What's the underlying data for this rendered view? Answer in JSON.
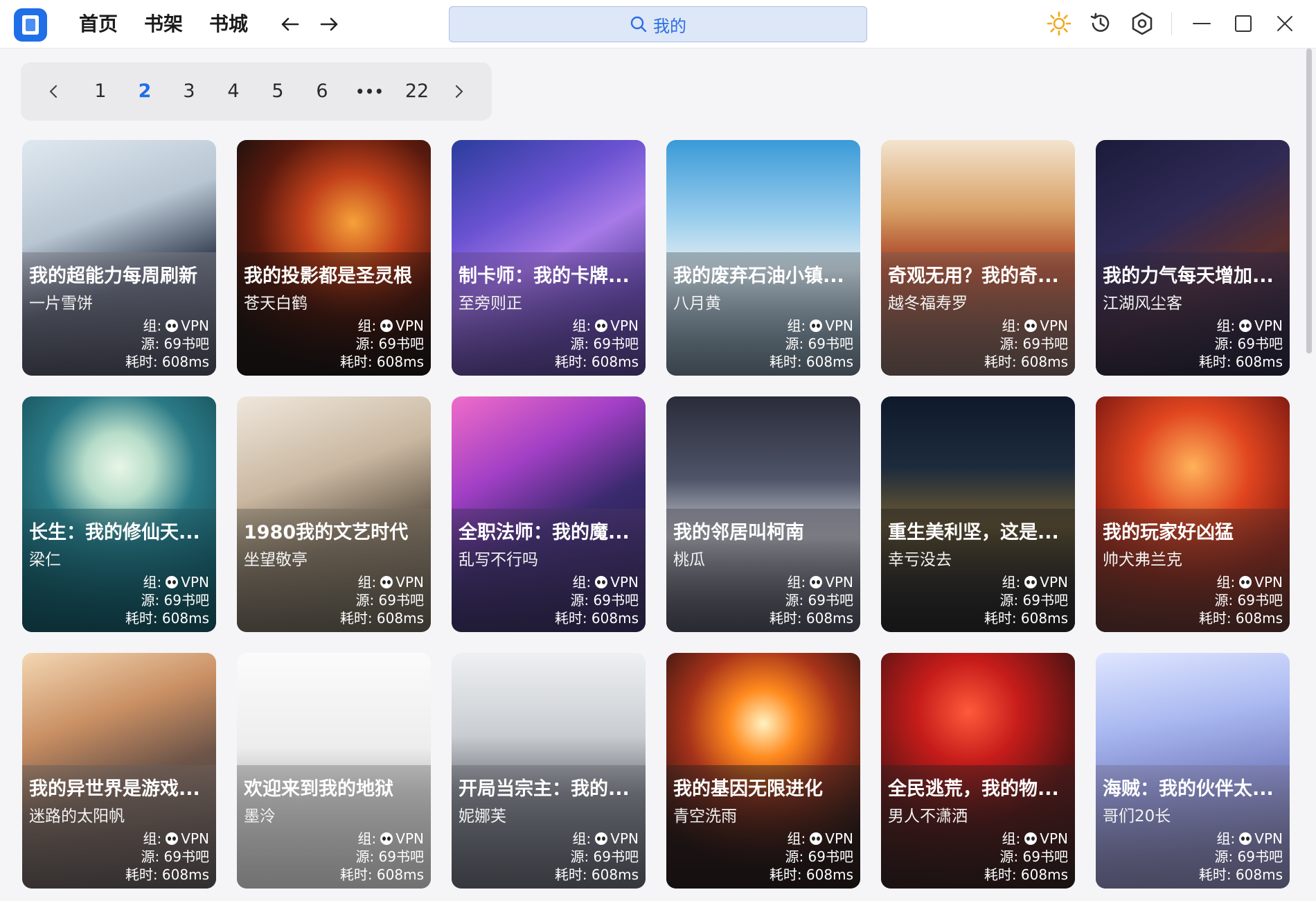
{
  "nav": {
    "home": "首页",
    "shelf": "书架",
    "store": "书城"
  },
  "search": {
    "query": "我的"
  },
  "pagination": {
    "pages": [
      "1",
      "2",
      "3",
      "4",
      "5",
      "6"
    ],
    "active": "2",
    "ellipsis": "•••",
    "last": "22"
  },
  "colors": {
    "accent": "#1f6ee6",
    "search_bg": "#dde7f8",
    "sun": "#f2a81d"
  },
  "icons": [
    "app-logo-icon",
    "back-arrow-icon",
    "forward-arrow-icon",
    "search-icon",
    "sun-icon",
    "history-icon",
    "settings-icon",
    "minimize-icon",
    "maximize-icon",
    "close-icon"
  ],
  "books": [
    {
      "title": "我的超能力每周刷新",
      "author": "一片雪饼",
      "group": "组:",
      "group_val": "VPN",
      "source": "源: 69书吧",
      "time": "耗时: 608ms"
    },
    {
      "title": "我的投影都是圣灵根",
      "author": "苍天白鹤",
      "group": "组:",
      "group_val": "VPN",
      "source": "源: 69书吧",
      "time": "耗时: 608ms"
    },
    {
      "title": "制卡师：我的卡牌...",
      "author": "至旁则正",
      "group": "组:",
      "group_val": "VPN",
      "source": "源: 69书吧",
      "time": "耗时: 608ms"
    },
    {
      "title": "我的废弃石油小镇...",
      "author": "八月黄",
      "group": "组:",
      "group_val": "VPN",
      "source": "源: 69书吧",
      "time": "耗时: 608ms"
    },
    {
      "title": "奇观无用？我的奇...",
      "author": "越冬福寿罗",
      "group": "组:",
      "group_val": "VPN",
      "source": "源: 69书吧",
      "time": "耗时: 608ms"
    },
    {
      "title": "我的力气每天增加...",
      "author": "江湖风尘客",
      "group": "组:",
      "group_val": "VPN",
      "source": "源: 69书吧",
      "time": "耗时: 608ms"
    },
    {
      "title": "长生：我的修仙天...",
      "author": "梁仁",
      "group": "组:",
      "group_val": "VPN",
      "source": "源: 69书吧",
      "time": "耗时: 608ms"
    },
    {
      "title": "1980我的文艺时代",
      "author": "坐望敬亭",
      "group": "组:",
      "group_val": "VPN",
      "source": "源: 69书吧",
      "time": "耗时: 608ms"
    },
    {
      "title": "全职法师：我的魔...",
      "author": "乱写不行吗",
      "group": "组:",
      "group_val": "VPN",
      "source": "源: 69书吧",
      "time": "耗时: 608ms"
    },
    {
      "title": "我的邻居叫柯南",
      "author": "桃瓜",
      "group": "组:",
      "group_val": "VPN",
      "source": "源: 69书吧",
      "time": "耗时: 608ms"
    },
    {
      "title": "重生美利坚，这是...",
      "author": "幸亏没去",
      "group": "组:",
      "group_val": "VPN",
      "source": "源: 69书吧",
      "time": "耗时: 608ms"
    },
    {
      "title": "我的玩家好凶猛",
      "author": "帅犬弗兰克",
      "group": "组:",
      "group_val": "VPN",
      "source": "源: 69书吧",
      "time": "耗时: 608ms"
    },
    {
      "title": "我的异世界是游戏...",
      "author": "迷路的太阳帆",
      "group": "组:",
      "group_val": "VPN",
      "source": "源: 69书吧",
      "time": "耗时: 608ms"
    },
    {
      "title": "欢迎来到我的地狱",
      "author": "墨泠",
      "group": "组:",
      "group_val": "VPN",
      "source": "源: 69书吧",
      "time": "耗时: 608ms"
    },
    {
      "title": "开局当宗主：我的...",
      "author": "妮娜芙",
      "group": "组:",
      "group_val": "VPN",
      "source": "源: 69书吧",
      "time": "耗时: 608ms"
    },
    {
      "title": "我的基因无限进化",
      "author": "青空洗雨",
      "group": "组:",
      "group_val": "VPN",
      "source": "源: 69书吧",
      "time": "耗时: 608ms"
    },
    {
      "title": "全民逃荒，我的物...",
      "author": "男人不潇洒",
      "group": "组:",
      "group_val": "VPN",
      "source": "源: 69书吧",
      "time": "耗时: 608ms"
    },
    {
      "title": "海贼：我的伙伴太...",
      "author": "哥们20长",
      "group": "组:",
      "group_val": "VPN",
      "source": "源: 69书吧",
      "time": "耗时: 608ms"
    }
  ]
}
